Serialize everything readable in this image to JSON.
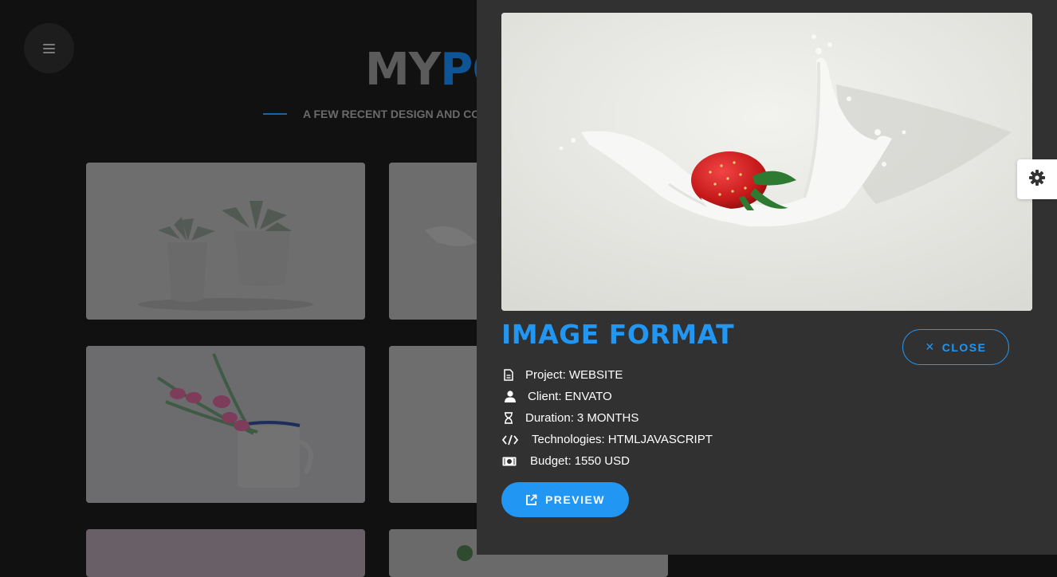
{
  "background": {
    "menu_icon": "hamburger-icon",
    "title_part1": "MY",
    "title_part2": "PO",
    "subtitle": "A FEW RECENT DESIGN AND COD",
    "tiles": [
      {
        "name": "succulents-image"
      },
      {
        "name": "milk-splash-image"
      },
      {
        "name": "tulips-mug-image"
      },
      {
        "name": "portfolio-image-4"
      },
      {
        "name": "portfolio-image-5"
      },
      {
        "name": "portfolio-image-6"
      }
    ]
  },
  "panel": {
    "hero_image": "strawberry-milk-splash",
    "title": "IMAGE FORMAT",
    "close_label": "CLOSE",
    "preview_label": "PREVIEW",
    "settings_icon": "gear-icon",
    "meta": [
      {
        "icon": "document-icon",
        "label": "Project:",
        "value": "WEBSITE"
      },
      {
        "icon": "user-icon",
        "label": "Client:",
        "value": "ENVATO"
      },
      {
        "icon": "hourglass-icon",
        "label": "Duration:",
        "value": "3 MONTHS"
      },
      {
        "icon": "code-icon",
        "label": "Technologies:",
        "value": "HTMLJAVASCRIPT"
      },
      {
        "icon": "money-icon",
        "label": "Budget:",
        "value": "1550 USD"
      }
    ]
  },
  "colors": {
    "accent": "#2196f3",
    "panel_bg": "#313131",
    "page_bg": "#111111"
  }
}
